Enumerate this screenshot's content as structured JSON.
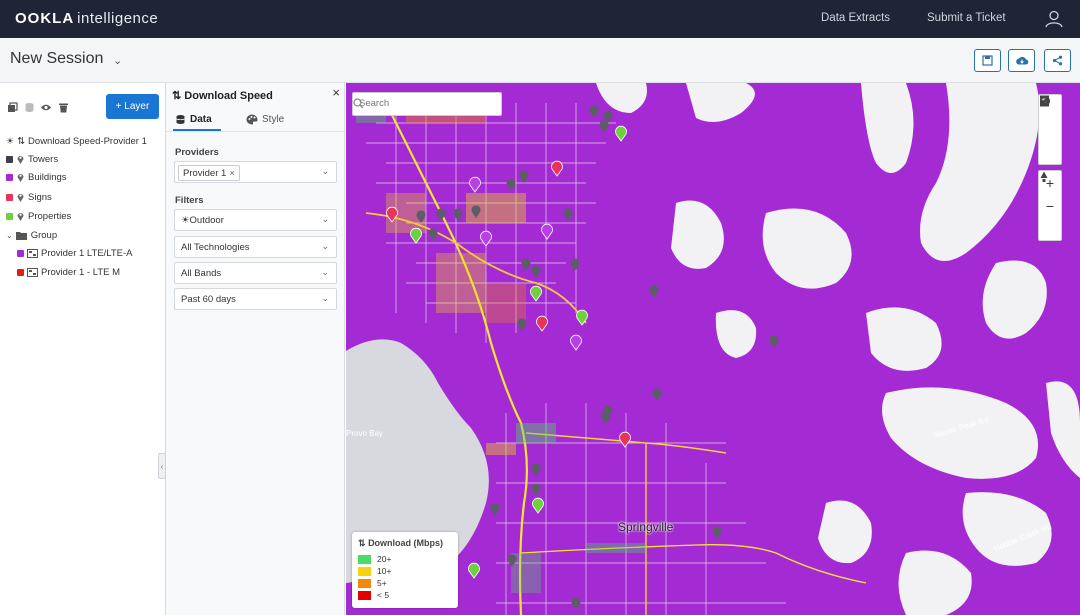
{
  "topbar": {
    "logo_bold": "OOKLA",
    "logo_light": "intelligence",
    "links": [
      "Data Extracts",
      "Submit a Ticket"
    ],
    "user_icon": "user-icon"
  },
  "session": {
    "title": "New Session",
    "actions": [
      "save-icon",
      "cloud-download-icon",
      "share-icon"
    ]
  },
  "layers": {
    "add_label": "+ Layer",
    "items": [
      {
        "label": "Download Speed-Provider 1",
        "icon": "speed-arrows-icon"
      },
      {
        "label": "Towers",
        "color": "#3b3f4a"
      },
      {
        "label": "Buildings",
        "color": "#a42bd3"
      },
      {
        "label": "Signs",
        "color": "#e8345a"
      },
      {
        "label": "Properties",
        "color": "#6bd13c"
      },
      {
        "label": "Group",
        "icon": "folder-icon"
      },
      {
        "label": "Provider 1 LTE/LTE-A",
        "color": "#a42bd3"
      },
      {
        "label": "Provider 1 - LTE M",
        "color": "#e21b1b"
      }
    ]
  },
  "settings": {
    "title": "Download Speed",
    "tabs": [
      "Data",
      "Style"
    ],
    "providers_label": "Providers",
    "provider_chip": "Provider 1",
    "filters_label": "Filters",
    "filters": [
      "Outdoor",
      "All Technologies",
      "All Bands",
      "Past 60 days"
    ]
  },
  "map": {
    "search_placeholder": "Search",
    "labels": [
      "Provo Bay",
      "Squaw Peak Rd",
      "Hobble Creek Rd"
    ],
    "city": "Springville",
    "legend": {
      "title": "Download (Mbps)",
      "items": [
        {
          "label": "20+",
          "color": "#4cd964"
        },
        {
          "label": "10+",
          "color": "#f5d40f"
        },
        {
          "label": "5+",
          "color": "#f08a0c"
        },
        {
          "label": "< 5",
          "color": "#e60000"
        }
      ]
    }
  }
}
